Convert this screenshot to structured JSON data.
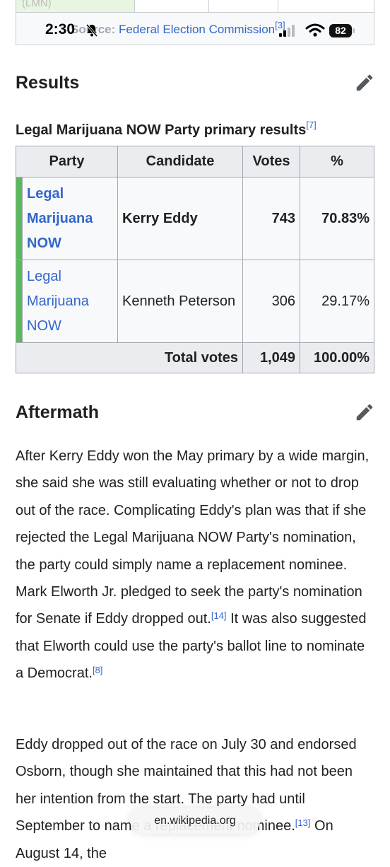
{
  "status_bar": {
    "time": "2:30",
    "battery": "82"
  },
  "top_table": {
    "partial_text": "(LMN)",
    "source_label": "Source:",
    "source_link": "Federal Election Commission",
    "source_ref": "[3]"
  },
  "results_section": {
    "heading": "Results",
    "caption": "Legal Marijuana NOW Party primary results",
    "caption_ref": "[7]",
    "columns": [
      "Party",
      "Candidate",
      "Votes",
      "%"
    ],
    "rows": [
      {
        "party": "Legal Marijuana NOW",
        "candidate": "Kerry Eddy",
        "votes": "743",
        "percent": "70.83%",
        "winner": true
      },
      {
        "party": "Legal Marijuana NOW",
        "candidate": "Kenneth Peterson",
        "votes": "306",
        "percent": "29.17%",
        "winner": false
      }
    ],
    "total_label": "Total votes",
    "total_votes": "1,049",
    "total_percent": "100.00%",
    "party_color": "#5cb85c"
  },
  "aftermath_section": {
    "heading": "Aftermath",
    "p1_text": "After Kerry Eddy won the May primary by a wide margin, she said she was still evaluating whether or not to drop out of the race. Complicating Eddy's plan was that if she rejected the Legal Marijuana NOW Party's nomination, the party could simply name a replacement nominee. Mark Elworth Jr. pledged to seek the party's nomination for Senate if Eddy dropped out.",
    "p1_ref1": "[14]",
    "p1_text2": " It was also suggested that Elworth could use the party's ballot line to nominate a Democrat.",
    "p1_ref2": "[8]",
    "p2_text": "Eddy dropped out of the race on July 30 and endorsed Osborn, though she maintained that this had not been her intention from the start. The party had until September ",
    "p2_text2": " to name a replacement nominee.",
    "p2_ref": "[13]",
    "p2_tail": " On August 14, the"
  },
  "browser": {
    "url": "en.wikipedia.org"
  },
  "icons": [
    "bell-slash-icon",
    "signal-icon",
    "wifi-icon",
    "battery-icon",
    "pencil-edit-icon"
  ]
}
